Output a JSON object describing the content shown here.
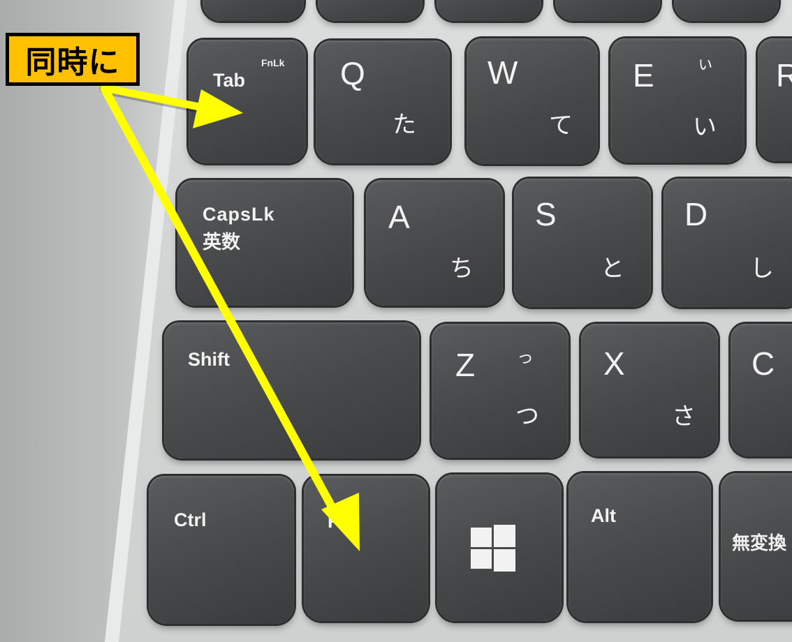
{
  "callout": {
    "text": "同時に",
    "background": "#ffc000"
  },
  "arrow_color": "#ffff00",
  "keys": {
    "tab": {
      "label": "Tab",
      "sub": "FnLk"
    },
    "q": {
      "label": "Q",
      "kana": "た"
    },
    "w": {
      "label": "W",
      "kana": "て"
    },
    "e": {
      "label": "E",
      "kana_small": "ぃ",
      "kana": "い"
    },
    "r": {
      "label": "R"
    },
    "caps": {
      "label": "CapsLk",
      "sub": "英数"
    },
    "a": {
      "label": "A",
      "kana": "ち"
    },
    "s": {
      "label": "S",
      "kana": "と"
    },
    "d": {
      "label": "D",
      "kana": "し"
    },
    "shift": {
      "label": "Shift"
    },
    "z": {
      "label": "Z",
      "kana_small": "っ",
      "kana": "つ"
    },
    "x": {
      "label": "X",
      "kana": "さ"
    },
    "c": {
      "label": "C"
    },
    "ctrl": {
      "label": "Ctrl"
    },
    "fn": {
      "label": "Fn"
    },
    "win": {
      "icon": "windows-logo-icon"
    },
    "alt": {
      "label": "Alt"
    },
    "muhenkan": {
      "label": "無変換"
    }
  }
}
